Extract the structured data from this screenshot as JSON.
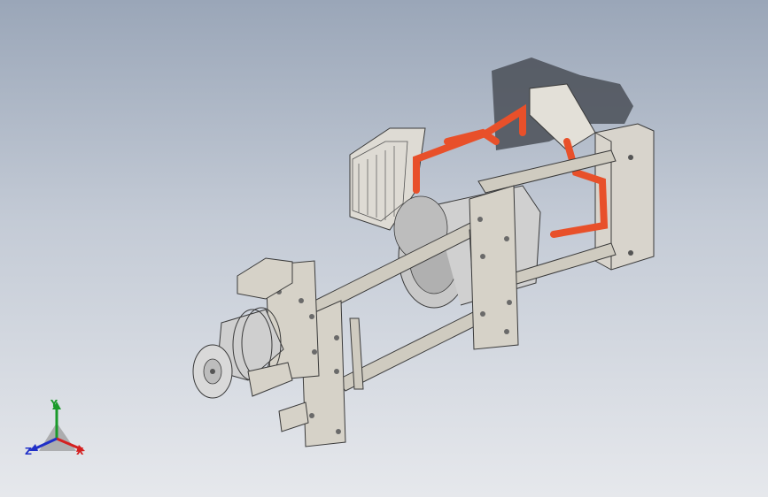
{
  "viewport": {
    "background_top": "#9aa6b8",
    "background_bottom": "#e6e8ec"
  },
  "model": {
    "part_colors": {
      "frame": "#cfcbc0",
      "frame_edge": "#3a3a3a",
      "coolant_pipe": "#e8502a",
      "motor": "#c8c8c8",
      "radiator": "#d8d4cc",
      "shadow": "#4a4f57"
    }
  },
  "triad": {
    "y_label": "Y",
    "x_label": "X",
    "z_label": "Z",
    "colors": {
      "x": "#d42020",
      "y": "#1a9a2a",
      "z": "#2030c8"
    }
  }
}
